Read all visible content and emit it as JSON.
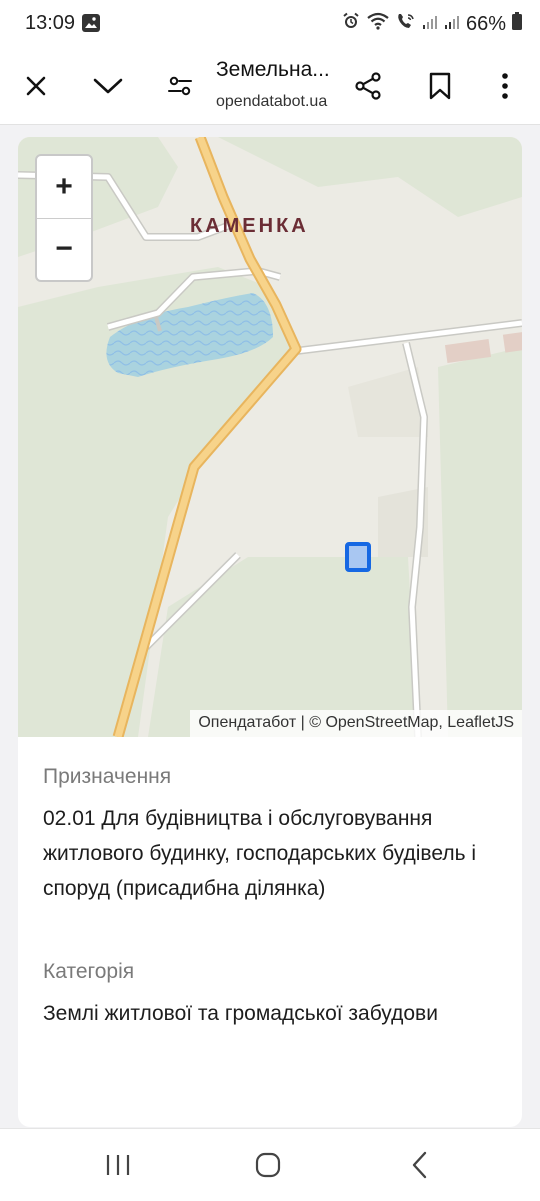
{
  "status_bar": {
    "time": "13:09",
    "battery": "66%",
    "icons": [
      "gallery-icon",
      "alarm-icon",
      "wifi-icon",
      "wifi-call-icon",
      "signal-icon",
      "signal-icon",
      "battery-icon"
    ]
  },
  "toolbar": {
    "title": "Земельна...",
    "url": "opendatabot.ua",
    "icons": [
      "close-icon",
      "chevron-down-icon",
      "tune-icon",
      "share-icon",
      "bookmark-icon",
      "more-vert-icon"
    ]
  },
  "map": {
    "zoom_in": "+",
    "zoom_out": "−",
    "place_label": "КАМЕНКА",
    "attribution": "Опендатабот | © OpenStreetMap, LeafletJS",
    "colors": {
      "land": "#ecebe4",
      "forest": "#dfe6d6",
      "water": "#aad3df",
      "road": "#f7d38a",
      "parcel": "#1668e3"
    }
  },
  "details": {
    "purpose_label": "Призначення",
    "purpose_value": "02.01 Для будівництва і обслуговування житлового будинку, господарських будівель і споруд (присадибна ділянка)",
    "category_label": "Категорія",
    "category_value": "Землі житлової та громадської забудови"
  },
  "nav_bar": {
    "icons": [
      "recent-apps-icon",
      "home-icon",
      "back-icon"
    ]
  }
}
